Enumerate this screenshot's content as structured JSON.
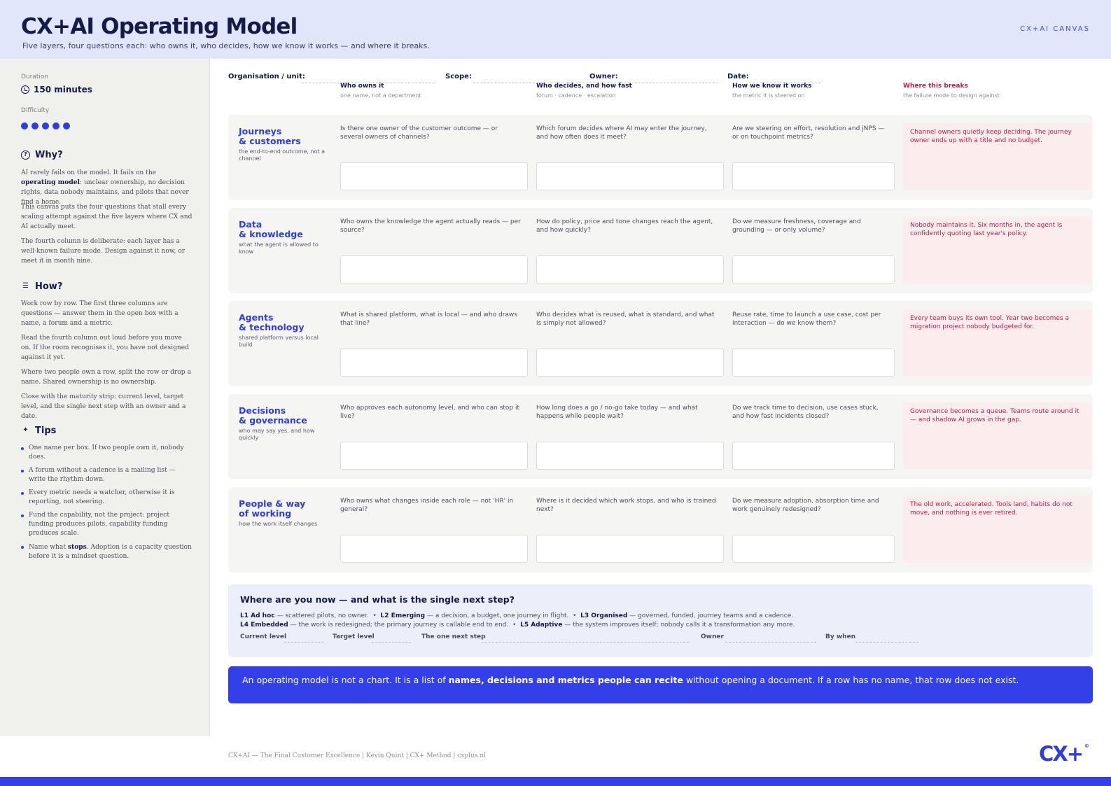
{
  "header": {
    "title": "CX+AI Operating Model",
    "subtitle": "Five layers, four questions each: who owns it, who decides, how we know it works — and where it breaks.",
    "tag": "CX+AI CANVAS"
  },
  "sidebar": {
    "duration_label": "Duration",
    "duration_value": "150 minutes",
    "difficulty_label": "Difficulty",
    "difficulty_level": 5,
    "why": {
      "heading": "Why?",
      "p1_a": "AI rarely fails on the model. It fails on the ",
      "p1_b": "operating model",
      "p1_c": ": unclear ownership, no decision rights, data nobody maintains, and pilots that never find a home.",
      "p2": "This canvas puts the four questions that stall every scaling attempt against the five layers where CX and AI actually meet.",
      "p3": "The fourth column is deliberate: each layer has a well-known failure mode. Design against it now, or meet it in month nine."
    },
    "how": {
      "heading": "How?",
      "p1": "Work row by row. The first three columns are questions — answer them in the open box with a name, a forum and a metric.",
      "p2": "Read the fourth column out loud before you move on. If the room recognises it, you have not designed against it yet.",
      "p3": "Where two people own a row, split the row or drop a name. Shared ownership is no ownership.",
      "p4": "Close with the maturity strip: current level, target level, and the single next step with an owner and a date."
    },
    "tips": {
      "heading": "Tips",
      "t1": "One name per box. If two people own it, nobody does.",
      "t2": "A forum without a cadence is a mailing list — write the rhythm down.",
      "t3": "Every metric needs a watcher, otherwise it is reporting, not steering.",
      "t4": "Fund the capability, not the project: project funding produces pilots, capability funding produces scale.",
      "t5_a": "Name what ",
      "t5_b": "stops",
      "t5_c": ". Adoption is a capacity question before it is a mindset question."
    }
  },
  "meta": {
    "org": "Organisation / unit:",
    "scope": "Scope:",
    "owner": "Owner:",
    "date": "Date:"
  },
  "columns": [
    {
      "title": "Who owns it",
      "sub": "one name, not a department"
    },
    {
      "title": "Who decides, and how fast",
      "sub": "forum · cadence · escalation"
    },
    {
      "title": "How we know it works",
      "sub": "the metric it is steered on"
    },
    {
      "title": "Where this breaks",
      "sub": "the failure mode to design against"
    }
  ],
  "rows": [
    {
      "title_1": "Journeys",
      "title_2": "& customers",
      "sub": "the end-to-end outcome, not a channel",
      "q1": "Is there one owner of the customer outcome — or several owners of channels?",
      "q2": "Which forum decides where AI may enter the journey, and how often does it meet?",
      "q3": "Are we steering on effort, resolution and jNPS — or on touchpoint metrics?",
      "breaks": "Channel owners quietly keep deciding. The journey owner ends up with a title and no budget."
    },
    {
      "title_1": "Data",
      "title_2": "& knowledge",
      "sub": "what the agent is allowed to know",
      "q1": "Who owns the knowledge the agent actually reads — per source?",
      "q2": "How do policy, price and tone changes reach the agent, and how quickly?",
      "q3": "Do we measure freshness, coverage and grounding — or only volume?",
      "breaks": "Nobody maintains it. Six months in, the agent is confidently quoting last year's policy."
    },
    {
      "title_1": "Agents",
      "title_2": "& technology",
      "sub": "shared platform versus local build",
      "q1": "What is shared platform, what is local — and who draws that line?",
      "q2": "Who decides what is reused, what is standard, and what is simply not allowed?",
      "q3": "Reuse rate, time to launch a use case, cost per interaction — do we know them?",
      "breaks": "Every team buys its own tool. Year two becomes a migration project nobody budgeted for."
    },
    {
      "title_1": "Decisions",
      "title_2": "& governance",
      "sub": "who may say yes, and how quickly",
      "q1": "Who approves each autonomy level, and who can stop it live?",
      "q2": "How long does a go / no-go take today — and what happens while people wait?",
      "q3": "Do we track time to decision, use cases stuck, and how fast incidents closed?",
      "breaks": "Governance becomes a queue. Teams route around it — and shadow AI grows in the gap."
    },
    {
      "title_1": "People & way",
      "title_2": "of working",
      "sub": "how the work itself changes",
      "q1": "Who owns what changes inside each role — not 'HR' in general?",
      "q2": "Where is it decided which work stops, and who is trained next?",
      "q3": "Do we measure adoption, absorption time and work genuinely redesigned?",
      "breaks": "The old work, accelerated. Tools land, habits do not move, and nothing is ever retired."
    }
  ],
  "maturity": {
    "title": "Where are you now — and what is the single next step?",
    "l1_name": "L1 Ad hoc",
    "l1_desc": " — scattered pilots, no owner.",
    "l2_name": "L2 Emerging",
    "l2_desc": " — a decision, a budget, one journey in flight.",
    "l3_name": "L3 Organised",
    "l3_desc": " — governed, funded, journey teams and a cadence.",
    "l4_name": "L4 Embedded",
    "l4_desc": " — the work is redesigned; the primary journey is callable end to end.",
    "l5_name": "L5 Adaptive",
    "l5_desc": " — the system improves itself; nobody calls it a transformation any more.",
    "sep": "•",
    "f_current": "Current level",
    "f_target": "Target level",
    "f_next": "The one next step",
    "f_owner": "Owner",
    "f_when": "By when"
  },
  "banner": {
    "a": "An operating model is not a chart. It is a list of ",
    "b": "names, decisions and metrics people can recite",
    "c": " without opening a document. If a row has no name, that row does not exist."
  },
  "footer": {
    "text": "CX+AI — The Final Customer Excellence | Kevin Quint | CX+ Method | cxplus.nl",
    "logo": "CX+",
    "logo_mark": "©"
  },
  "colors": {
    "accent": "#2e3de0",
    "banner": "#3340e8",
    "header_bg": "#e1e6fa",
    "danger_text": "#b3224a",
    "danger_bg": "#fbecee"
  }
}
